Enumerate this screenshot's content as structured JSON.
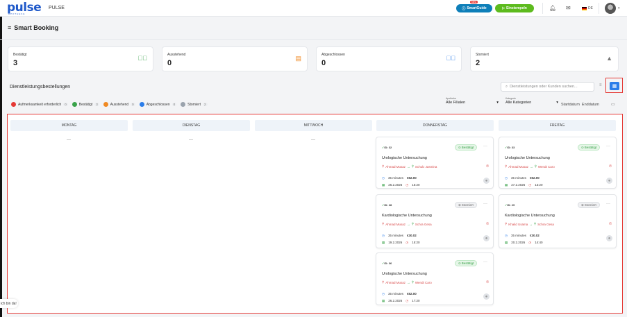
{
  "header": {
    "brand": "PULSE",
    "logo_text": "pulse",
    "logo_sub": "APOTHEKE",
    "new_badge": "New",
    "smart_guide": "SmartGuide",
    "einstempeln": "Einstempeln",
    "lang": "DE",
    "icons": [
      "bell-icon",
      "mail-icon",
      "flag-de-icon"
    ]
  },
  "page": {
    "title": "Smart Booking"
  },
  "stats": [
    {
      "label": "Bestätigt",
      "value": "3",
      "icon": "check-circle-icon",
      "color": "#3aa34a"
    },
    {
      "label": "Ausstehend",
      "value": "0",
      "icon": "clipboard-icon",
      "color": "#f08a24"
    },
    {
      "label": "Abgeschlossen",
      "value": "0",
      "icon": "check-circle-icon",
      "color": "#2b7de9"
    },
    {
      "label": "Storniert",
      "value": "2",
      "icon": "warning-icon",
      "color": "#777777"
    }
  ],
  "section": {
    "title": "Dienstleistungsbestellungen",
    "search_placeholder": "Dienstleistungen oder Kunden suchen..."
  },
  "status_filters": [
    {
      "label": "Aufmerksamkeit erforderlich",
      "count": "0",
      "color": "#e53935"
    },
    {
      "label": "Bestätigt",
      "count": "3",
      "color": "#3aa34a"
    },
    {
      "label": "Ausstehend",
      "count": "0",
      "color": "#f08a24"
    },
    {
      "label": "Abgeschlossen",
      "count": "0",
      "color": "#2b7de9"
    },
    {
      "label": "Storniert",
      "count": "2",
      "color": "#9aa3ad"
    }
  ],
  "filters": {
    "apotheke_caption": "Apotheke",
    "apotheke_value": "Alle Filialen",
    "kategorie_caption": "Kategorie",
    "kategorie_value": "Alle Kategorien",
    "start_date": "Startdatum",
    "end_date": "Enddatum"
  },
  "columns": [
    {
      "day": "MONTAG",
      "empty": "—"
    },
    {
      "day": "DIENSTAG",
      "empty": "—"
    },
    {
      "day": "MITTWOCH",
      "empty": "—"
    },
    {
      "day": "DONNERSTAG"
    },
    {
      "day": "FREITAG"
    }
  ],
  "cards": [
    {
      "id": "ID: 32",
      "status": "Bestätigt",
      "service": "Urologische Untersuchung",
      "staff": "Ahmad Musaz",
      "customer": "Schulz Jasmina",
      "duration": "35 minutes",
      "price": "€52.00",
      "date": "26.2.2026",
      "time": "15:20"
    },
    {
      "id": "ID: 28",
      "status": "Storniert",
      "service": "Kardiologische Untersuchung",
      "staff": "Ahmad Musaz",
      "customer": "Schra Gesa",
      "duration": "35 minutes",
      "price": "€30.02",
      "date": "19.2.2026",
      "time": "15:20"
    },
    {
      "id": "ID: 36",
      "status": "Bestätigt",
      "service": "Urologische Untersuchung",
      "staff": "Ahmad Musaz",
      "customer": "Wendt Caro",
      "duration": "35 minutes",
      "price": "€52.00",
      "date": "26.2.2026",
      "time": "17:20"
    },
    {
      "id": "ID: 33",
      "status": "Bestätigt",
      "service": "Urologische Untersuchung",
      "staff": "Ahmad Musaz",
      "customer": "Wendt Caro",
      "duration": "35 minutes",
      "price": "€52.00",
      "date": "27.2.2026",
      "time": "13:20"
    },
    {
      "id": "ID: 29",
      "status": "Storniert",
      "service": "Kardiologische Untersuchung",
      "staff": "Khalid Usama",
      "customer": "Schra Gesa",
      "duration": "35 minutes",
      "price": "€30.02",
      "date": "20.2.2026",
      "time": "14:40"
    }
  ],
  "chat": {
    "label": "ich bin da!"
  }
}
